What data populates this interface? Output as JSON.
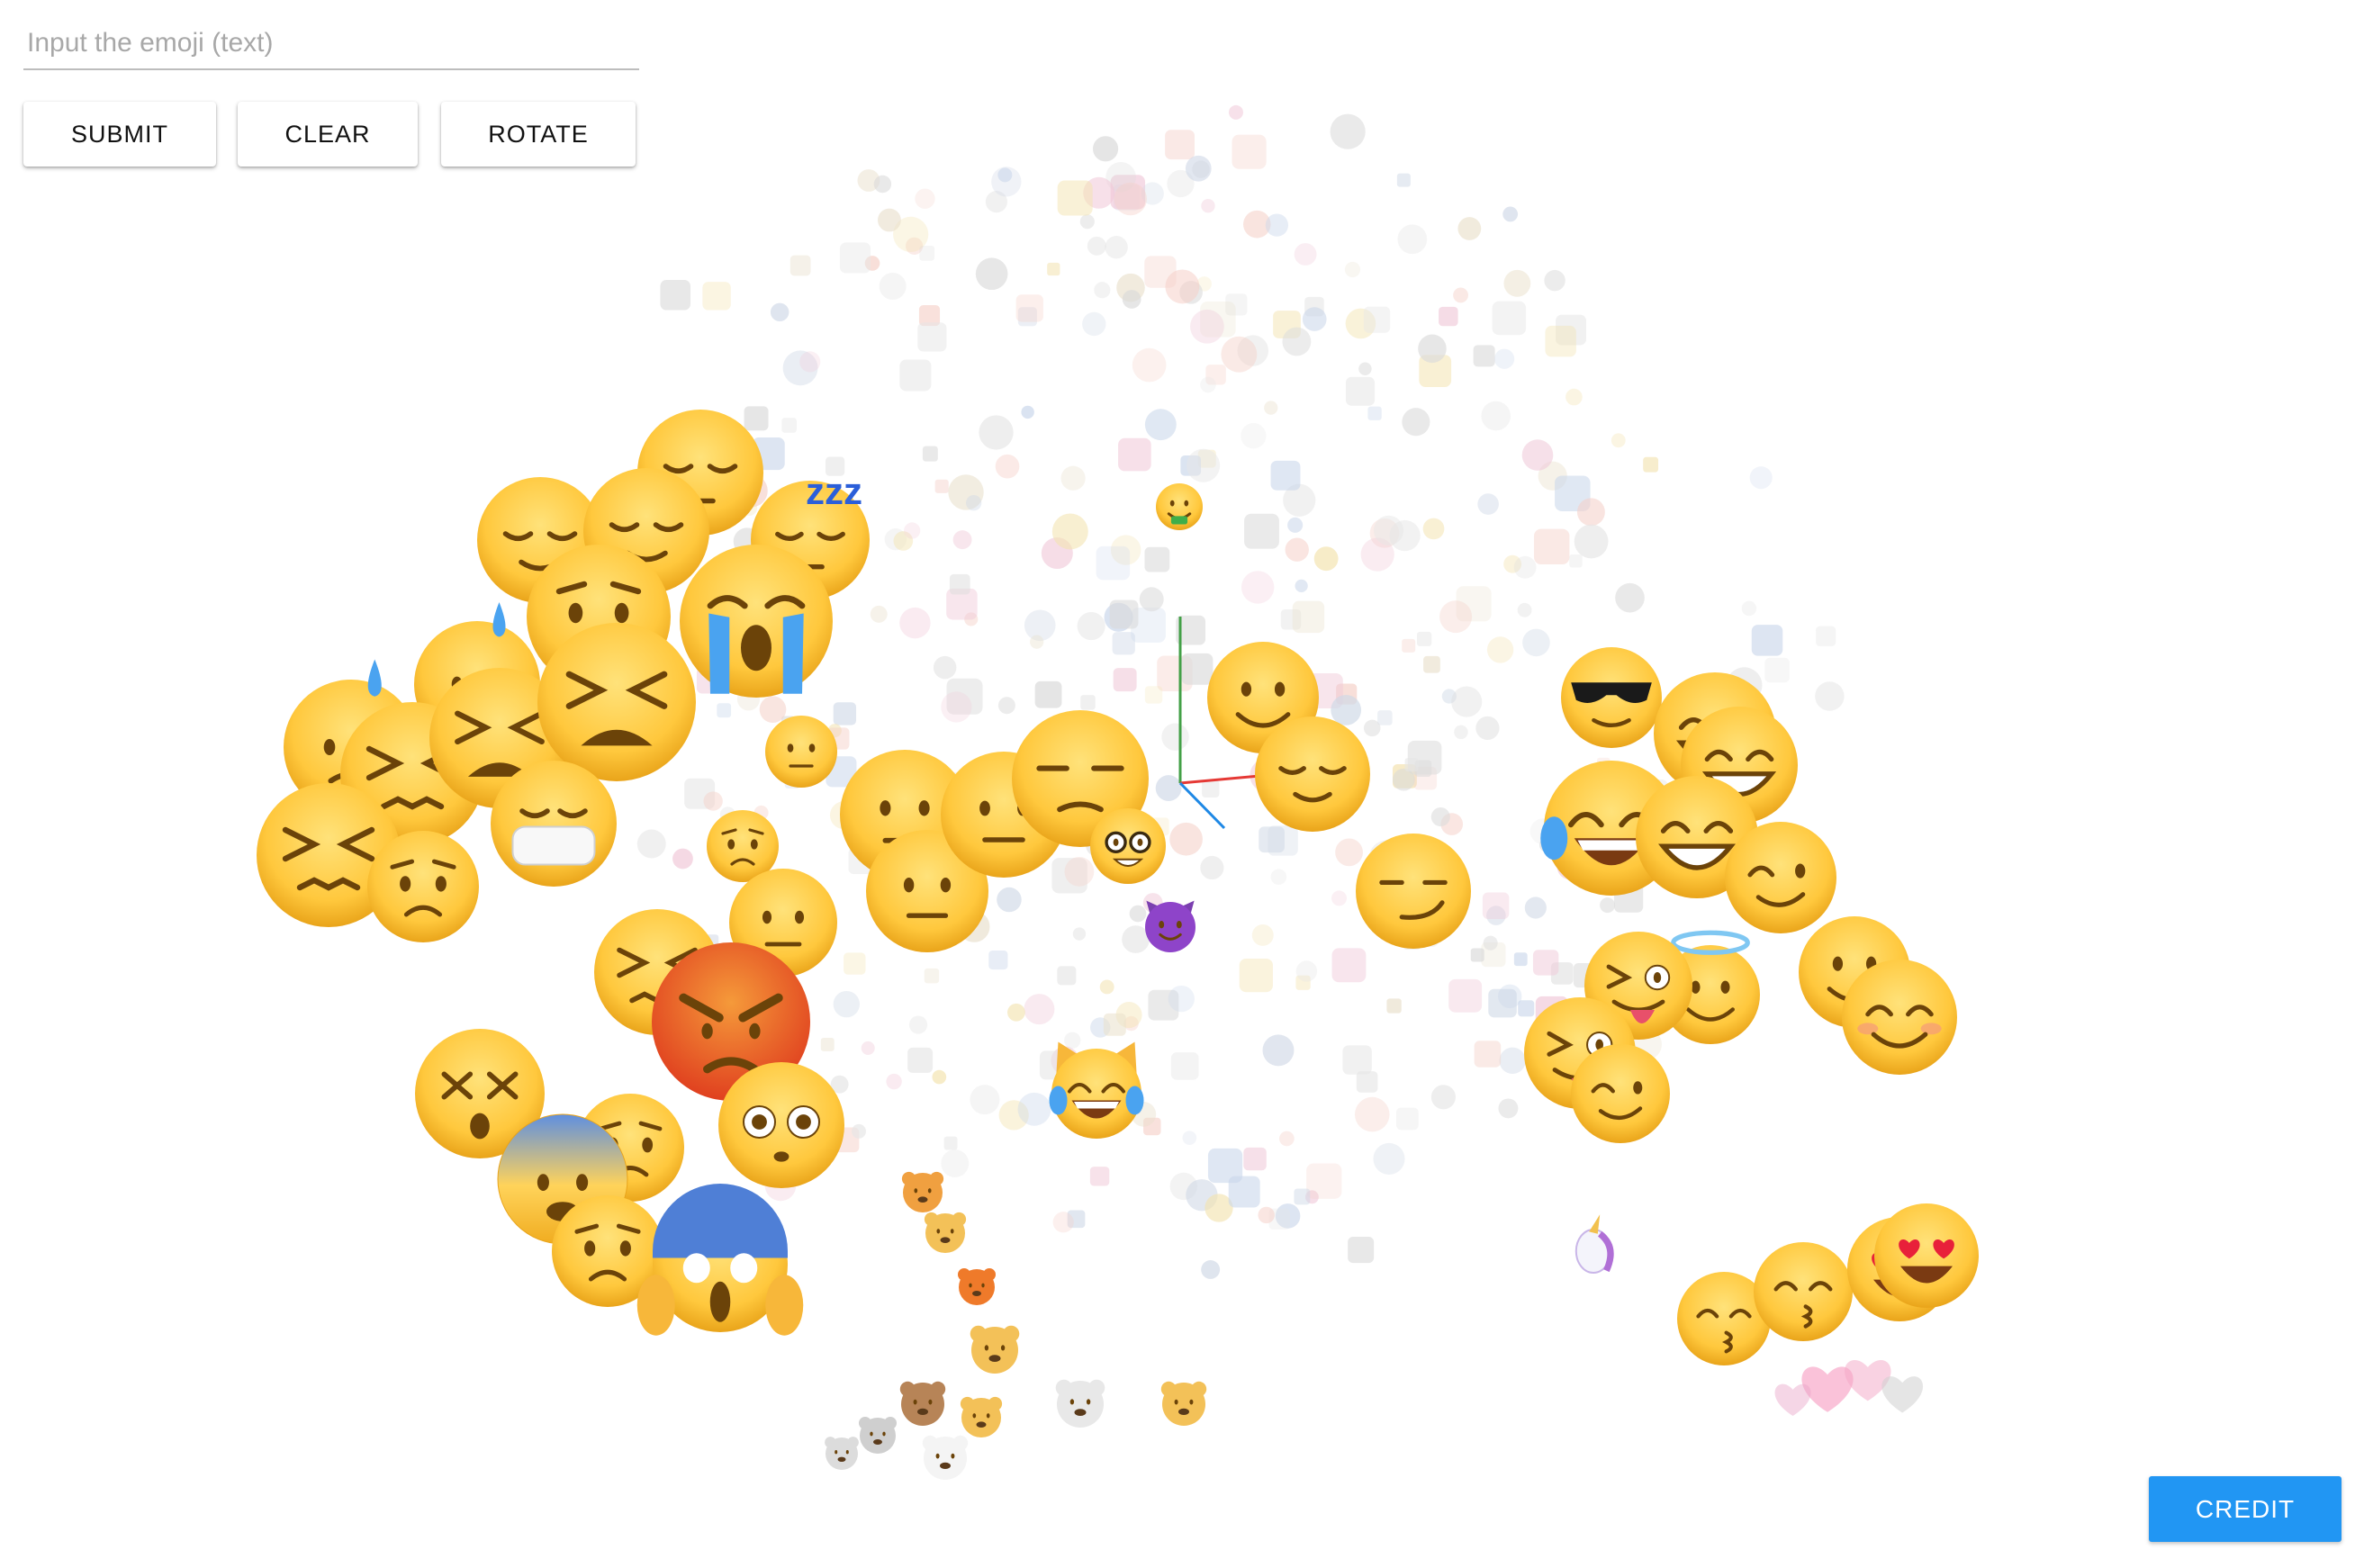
{
  "search": {
    "placeholder": "Input the emoji (text)",
    "value": ""
  },
  "buttons": {
    "submit": "SUBMIT",
    "clear": "CLEAR",
    "rotate": "ROTATE"
  },
  "credit_label": "CREDIT",
  "colors": {
    "face_light": "#ffe27a",
    "face_mid": "#ffc83d",
    "face_dark": "#e9a41a",
    "feature": "#6b4309",
    "angry": "#e8502a",
    "tear": "#4aa3f0",
    "axis_x": "#e53935",
    "axis_y": "#43a047",
    "axis_z": "#1e88e5",
    "primary": "#2196f3"
  },
  "emojis": [
    {
      "type": "sleepy",
      "icon": "sleepy-face-icon"
    },
    {
      "type": "relieved",
      "icon": "relieved-face-icon"
    },
    {
      "type": "zzz",
      "icon": "zzz-icon"
    },
    {
      "type": "crying",
      "icon": "loudly-crying-face-icon"
    },
    {
      "type": "worried",
      "icon": "worried-face-icon"
    },
    {
      "type": "sweat",
      "icon": "sweat-face-icon"
    },
    {
      "type": "weary",
      "icon": "weary-face-icon"
    },
    {
      "type": "confounded",
      "icon": "confounded-face-icon"
    },
    {
      "type": "mask",
      "icon": "mask-face-icon"
    },
    {
      "type": "angry",
      "icon": "angry-face-icon"
    },
    {
      "type": "dizzy",
      "icon": "dizzy-face-icon"
    },
    {
      "type": "fearful",
      "icon": "fearful-face-icon"
    },
    {
      "type": "scream",
      "icon": "screaming-face-icon"
    },
    {
      "type": "flushed",
      "icon": "flushed-face-icon"
    },
    {
      "type": "neutral",
      "icon": "neutral-face-icon"
    },
    {
      "type": "unamused",
      "icon": "unamused-face-icon"
    },
    {
      "type": "slight_smile",
      "icon": "slightly-smiling-face-icon"
    },
    {
      "type": "smirk",
      "icon": "smirking-face-icon"
    },
    {
      "type": "nerd",
      "icon": "nerd-face-icon"
    },
    {
      "type": "cat_joy",
      "icon": "cat-tears-of-joy-icon"
    },
    {
      "type": "money",
      "icon": "money-mouth-face-icon"
    },
    {
      "type": "devil",
      "icon": "smiling-devil-icon"
    },
    {
      "type": "cool",
      "icon": "sunglasses-face-icon"
    },
    {
      "type": "joy",
      "icon": "tears-of-joy-face-icon"
    },
    {
      "type": "grin",
      "icon": "grinning-face-icon"
    },
    {
      "type": "wink",
      "icon": "winking-face-icon"
    },
    {
      "type": "tongue",
      "icon": "winking-tongue-face-icon"
    },
    {
      "type": "halo",
      "icon": "smiling-face-halo-icon"
    },
    {
      "type": "blush",
      "icon": "smiling-blush-face-icon"
    },
    {
      "type": "heart_eyes",
      "icon": "heart-eyes-face-icon"
    },
    {
      "type": "kiss",
      "icon": "kissing-face-icon"
    },
    {
      "type": "unicorn",
      "icon": "unicorn-icon"
    },
    {
      "type": "animals",
      "icon": "animal-faces-icon"
    },
    {
      "type": "hearts",
      "icon": "hearts-icon"
    },
    {
      "type": "faint",
      "icon": "faded-emoji-icon"
    }
  ]
}
